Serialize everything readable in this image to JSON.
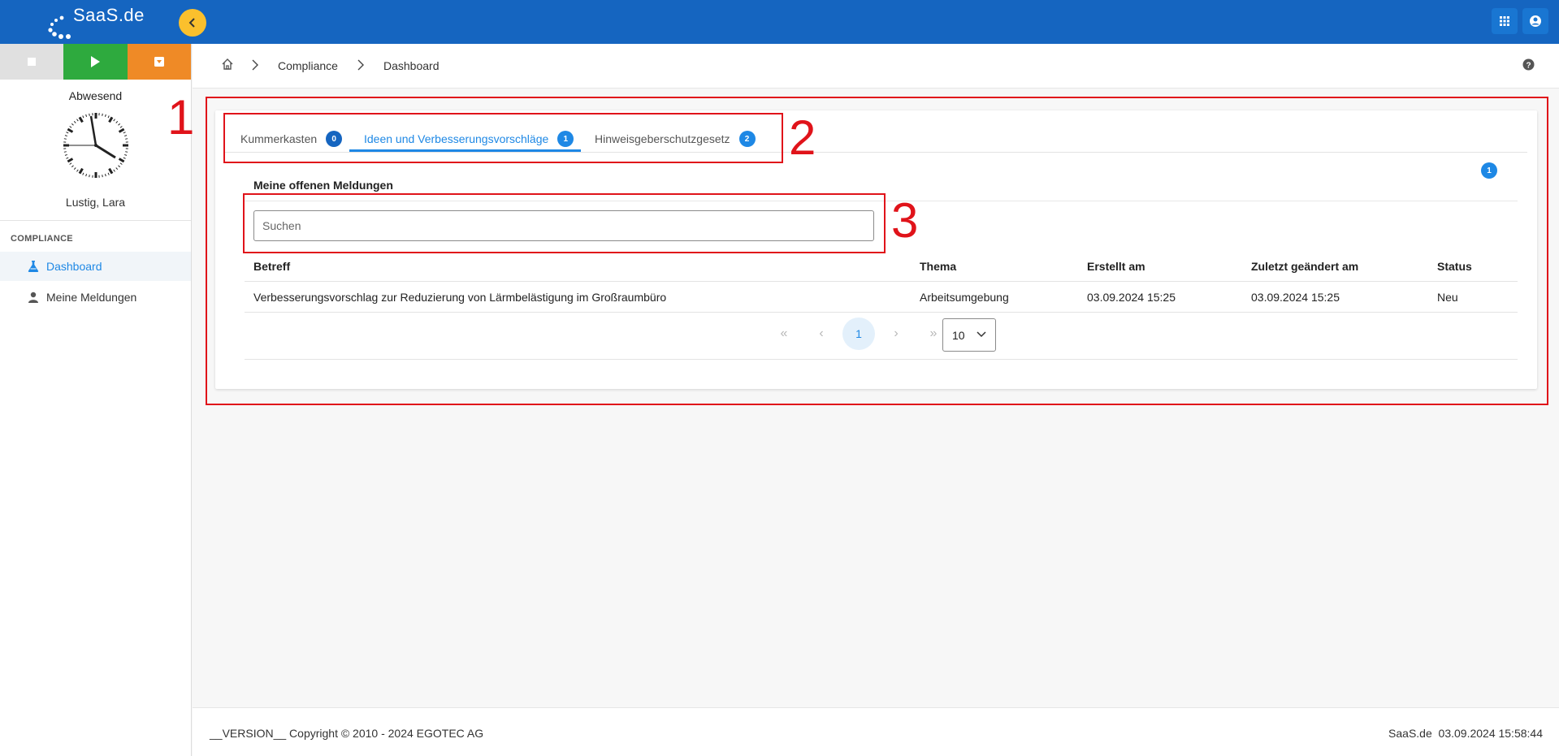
{
  "app": {
    "logo_text": "SaaS.de"
  },
  "sidebar": {
    "status": "Abwesend",
    "user_name": "Lustig, Lara",
    "section_label": "COMPLIANCE",
    "items": [
      {
        "label": "Dashboard",
        "icon": "dashboard-flask-icon",
        "active": true
      },
      {
        "label": "Meine Meldungen",
        "icon": "person-icon",
        "active": false
      }
    ]
  },
  "breadcrumb": {
    "items": [
      "Compliance",
      "Dashboard"
    ]
  },
  "annotations": [
    "1",
    "2",
    "3"
  ],
  "tabs": [
    {
      "label": "Kummerkasten",
      "count": "0",
      "active": false
    },
    {
      "label": "Ideen und Verbesserungsvorschläge",
      "count": "1",
      "active": true
    },
    {
      "label": "Hinweisgeberschutzgesetz",
      "count": "2",
      "active": false
    }
  ],
  "panel": {
    "badge_count": "1",
    "title": "Meine offenen Meldungen",
    "search_placeholder": "Suchen"
  },
  "table": {
    "columns": [
      "Betreff",
      "Thema",
      "Erstellt am",
      "Zuletzt geändert am",
      "Status"
    ],
    "rows": [
      [
        "Verbesserungsvorschlag zur Reduzierung von Lärmbelästigung im Großraumbüro",
        "Arbeitsumgebung",
        "03.09.2024 15:25",
        "03.09.2024 15:25",
        "Neu"
      ]
    ]
  },
  "pagination": {
    "current_page": "1",
    "page_size": "10"
  },
  "footer": {
    "left": "__VERSION__ Copyright © 2010 - 2024 EGOTEC AG",
    "right_brand": "SaaS.de",
    "right_time": "03.09.2024 15:58:44"
  },
  "colors": {
    "topbar": "#1565c0",
    "accent": "#1e88e5",
    "collapse": "#fbc02d",
    "play": "#2eaa3e",
    "pause": "#ef8a26",
    "annotation": "#e0131a"
  }
}
